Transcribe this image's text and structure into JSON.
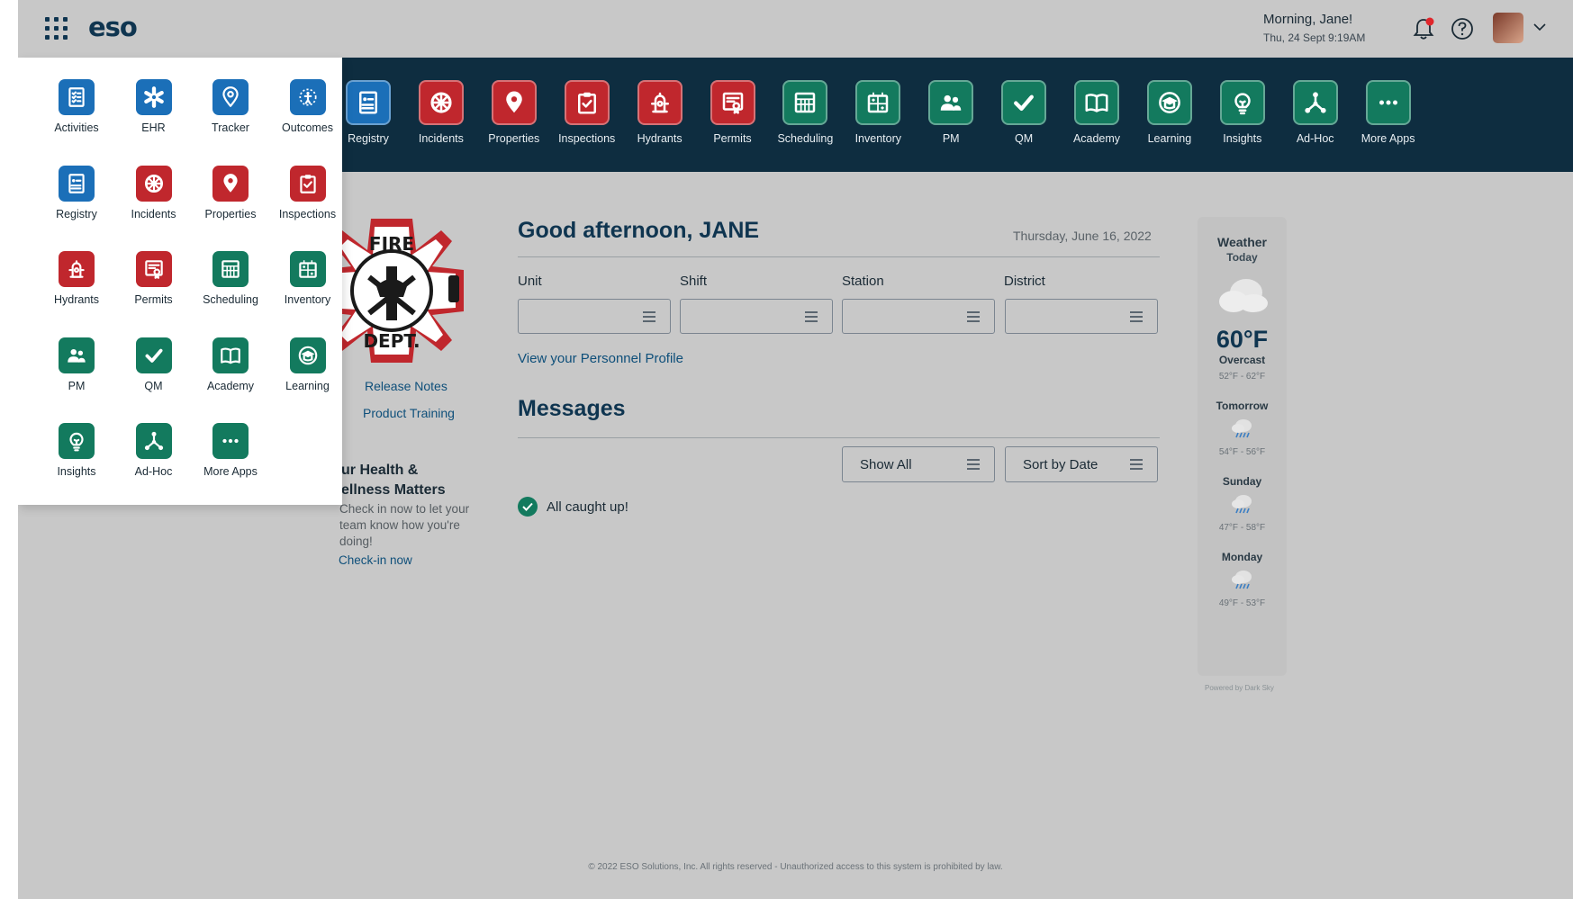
{
  "header": {
    "logo": "eso",
    "greeting": "Morning, Jane!",
    "datetime": "Thu, 24 Sept 9:19AM"
  },
  "app_bar": [
    {
      "label": "Registry",
      "color": "blue",
      "icon": "registry-icon"
    },
    {
      "label": "Incidents",
      "color": "red",
      "icon": "incidents-icon"
    },
    {
      "label": "Properties",
      "color": "red",
      "icon": "properties-icon"
    },
    {
      "label": "Inspections",
      "color": "red",
      "icon": "inspections-icon"
    },
    {
      "label": "Hydrants",
      "color": "red",
      "icon": "hydrants-icon"
    },
    {
      "label": "Permits",
      "color": "red",
      "icon": "permits-icon"
    },
    {
      "label": "Scheduling",
      "color": "green",
      "icon": "scheduling-icon"
    },
    {
      "label": "Inventory",
      "color": "green",
      "icon": "inventory-icon"
    },
    {
      "label": "PM",
      "color": "green",
      "icon": "pm-icon"
    },
    {
      "label": "QM",
      "color": "green",
      "icon": "qm-icon"
    },
    {
      "label": "Academy",
      "color": "green",
      "icon": "academy-icon"
    },
    {
      "label": "Learning",
      "color": "green",
      "icon": "learning-icon"
    },
    {
      "label": "Insights",
      "color": "green",
      "icon": "insights-icon"
    },
    {
      "label": "Ad-Hoc",
      "color": "green",
      "icon": "ad-hoc-icon"
    },
    {
      "label": "More Apps",
      "color": "green",
      "icon": "more-apps-icon"
    }
  ],
  "app_menu": [
    {
      "label": "Activities",
      "color": "blue",
      "icon": "activities-icon"
    },
    {
      "label": "EHR",
      "color": "blue",
      "icon": "ehr-icon"
    },
    {
      "label": "Tracker",
      "color": "blue",
      "icon": "tracker-icon"
    },
    {
      "label": "Outcomes",
      "color": "blue",
      "icon": "outcomes-icon"
    },
    {
      "label": "Registry",
      "color": "blue",
      "icon": "registry-icon"
    },
    {
      "label": "Incidents",
      "color": "red",
      "icon": "incidents-icon"
    },
    {
      "label": "Properties",
      "color": "red",
      "icon": "properties-icon"
    },
    {
      "label": "Inspections",
      "color": "red",
      "icon": "inspections-icon"
    },
    {
      "label": "Hydrants",
      "color": "red",
      "icon": "hydrants-icon"
    },
    {
      "label": "Permits",
      "color": "red",
      "icon": "permits-icon"
    },
    {
      "label": "Scheduling",
      "color": "green",
      "icon": "scheduling-icon"
    },
    {
      "label": "Inventory",
      "color": "green",
      "icon": "inventory-icon"
    },
    {
      "label": "PM",
      "color": "green",
      "icon": "pm-icon"
    },
    {
      "label": "QM",
      "color": "green",
      "icon": "qm-icon"
    },
    {
      "label": "Academy",
      "color": "green",
      "icon": "academy-icon"
    },
    {
      "label": "Learning",
      "color": "green",
      "icon": "learning-icon"
    },
    {
      "label": "Insights",
      "color": "green",
      "icon": "insights-icon"
    },
    {
      "label": "Ad-Hoc",
      "color": "green",
      "icon": "ad-hoc-icon"
    },
    {
      "label": "More Apps",
      "color": "green",
      "icon": "more-apps-icon"
    }
  ],
  "emblem": {
    "top_text": "FIRE",
    "bottom_text": "DEPT."
  },
  "sidebar_links": {
    "release_notes": "Release Notes",
    "product_training": "Product Training"
  },
  "wellness": {
    "title_line1": "ur Health &",
    "title_line2": "ellness Matters",
    "text": "Check in now to let your team know how you're doing!",
    "link": "Check-in now"
  },
  "main": {
    "greeting": "Good afternoon, JANE",
    "date": "Thursday, June 16, 2022",
    "fields": [
      {
        "label": "Unit",
        "value": ""
      },
      {
        "label": "Shift",
        "value": ""
      },
      {
        "label": "Station",
        "value": ""
      },
      {
        "label": "District",
        "value": ""
      }
    ],
    "profile_link": "View your Personnel Profile",
    "messages_title": "Messages",
    "filter_label": "Show All",
    "sort_label": "Sort by Date",
    "status": "All caught up!"
  },
  "weather": {
    "title": "Weather",
    "today_label": "Today",
    "temp": "60°F",
    "condition": "Overcast",
    "today_range": "52°F - 62°F",
    "forecast": [
      {
        "day": "Tomorrow",
        "range": "54°F - 56°F"
      },
      {
        "day": "Sunday",
        "range": "47°F - 58°F"
      },
      {
        "day": "Monday",
        "range": "49°F - 53°F"
      }
    ],
    "powered": "Powered by Dark Sky"
  },
  "footer": "© 2022 ESO Solutions, Inc. All rights reserved - Unauthorized access to this system is prohibited by law.",
  "colors": {
    "navy": "#0e2d40",
    "blue": "#1b6fb8",
    "red": "#c0272d",
    "green": "#137a5e",
    "notification": "#e0262b"
  }
}
